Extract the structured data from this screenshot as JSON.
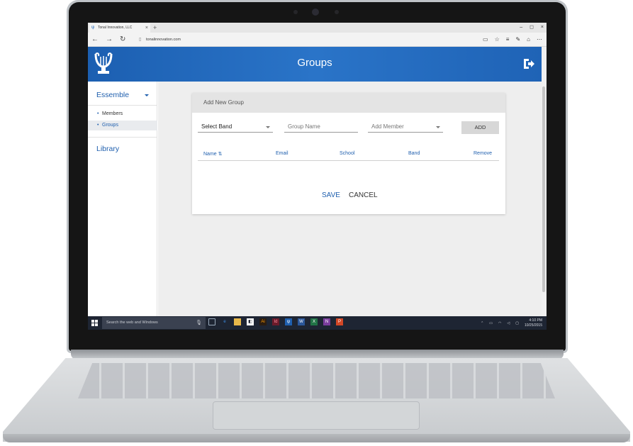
{
  "browser": {
    "tab_title": "Tonal Innovation, LLC",
    "tab_close": "×",
    "new_tab": "+",
    "url": "tonalinnovation.com",
    "win_minimize": "–",
    "win_maximize": "◻",
    "win_close": "×",
    "nav_back": "←",
    "nav_forward": "→",
    "nav_refresh": "↻"
  },
  "header": {
    "title": "Groups"
  },
  "sidebar": {
    "ensemble_label": "Essemble",
    "items": [
      {
        "label": "Members",
        "active": false
      },
      {
        "label": "Groups",
        "active": true
      }
    ],
    "library_label": "Library"
  },
  "card": {
    "title": "Add New Group",
    "band_select": "Select Band",
    "group_name_placeholder": "Group Name",
    "member_select": "Add Member",
    "add_button": "ADD",
    "columns": [
      "Name ⇅",
      "Email",
      "School",
      "Band",
      "Remove"
    ],
    "save_label": "SAVE",
    "cancel_label": "CANCEL"
  },
  "taskbar": {
    "search_placeholder": "Search the web and Windows",
    "time": "4:10 PM",
    "date": "10/25/2015"
  },
  "colors": {
    "brand_blue": "#1f5fae",
    "header_gradient_start": "#1c5fb1",
    "taskbar": "#1e2533"
  }
}
